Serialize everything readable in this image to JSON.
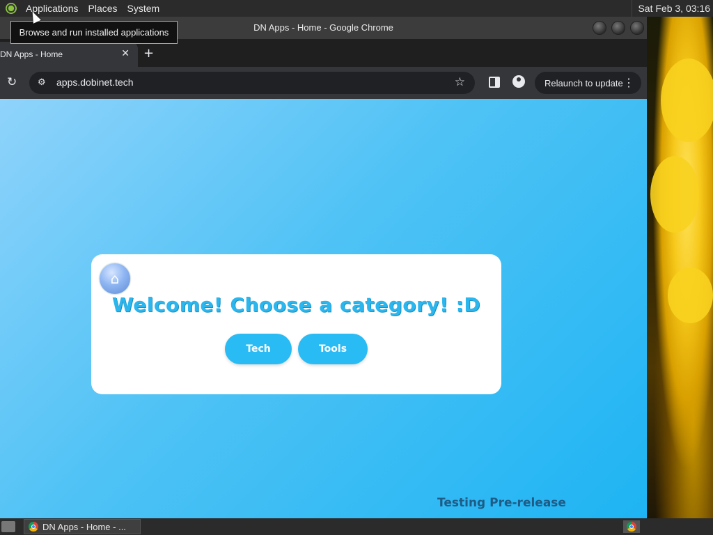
{
  "top_panel": {
    "menus": [
      "Applications",
      "Places",
      "System"
    ],
    "clock": "Sat Feb  3, 03:16"
  },
  "tooltip": "Browse and run installed applications",
  "window": {
    "title": "DN Apps - Home - Google Chrome",
    "tab_title": "DN Apps - Home",
    "url": "apps.dobinet.tech",
    "relaunch_label": "Relaunch to update"
  },
  "page": {
    "headline": "Welcome! Choose a category! :D",
    "categories": [
      "Tech",
      "Tools"
    ],
    "footer_note": "Testing Pre-release",
    "accent_color": "#29bbf3"
  },
  "taskbar": {
    "task_label": "DN Apps - Home - ..."
  }
}
